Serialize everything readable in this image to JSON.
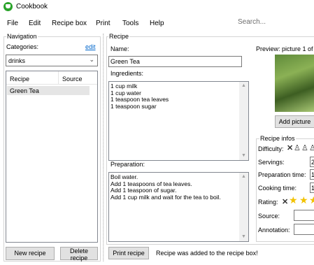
{
  "app": {
    "title": "Cookbook"
  },
  "menu": {
    "items": [
      "File",
      "Edit",
      "Recipe box",
      "Print",
      "Tools",
      "Help"
    ],
    "search_placeholder": "Search..."
  },
  "navigation": {
    "group_label": "Navigation",
    "categories_label": "Categories:",
    "edit_link": "edit",
    "category_selected": "drinks",
    "columns": [
      "Recipe",
      "Source"
    ],
    "recipes": [
      {
        "recipe": "Green Tea",
        "source": ""
      }
    ],
    "new_button": "New recipe",
    "delete_button": "Delete recipe"
  },
  "recipe": {
    "group_label": "Recipe",
    "name_label": "Name:",
    "name_value": "Green Tea",
    "ingredients_label": "Ingredients:",
    "ingredients": [
      "1 cup milk",
      "1 cup water",
      "1 teaspoon tea leaves",
      "1 teaspoon sugar"
    ],
    "preparation_label": "Preparation:",
    "preparation": [
      "Boil water.",
      "Add 1 teaspoons of tea leaves.",
      "Add 1 teaspoon of sugar.",
      "Add 1 cup milk and wait for the tea to boil."
    ],
    "print_button": "Print recipe",
    "status_message": "Recipe was added to the recipe box!"
  },
  "preview": {
    "label": "Preview: picture 1 of",
    "add_picture_button": "Add picture"
  },
  "infos": {
    "group_label": "Recipe infos",
    "difficulty_label": "Difficulty:",
    "servings_label": "Servings:",
    "servings_value": "2",
    "prep_time_label": "Preparation time:",
    "prep_time_value": "1",
    "cooking_time_label": "Cooking time:",
    "cooking_time_value": "1",
    "rating_label": "Rating:",
    "rating_stars": 3,
    "source_label": "Source:",
    "annotation_label": "Annotation:"
  },
  "colors": {
    "app_icon": "#2aa32a",
    "link": "#0066cc",
    "selection": "#e5e5e5",
    "star": "#f2c200"
  }
}
